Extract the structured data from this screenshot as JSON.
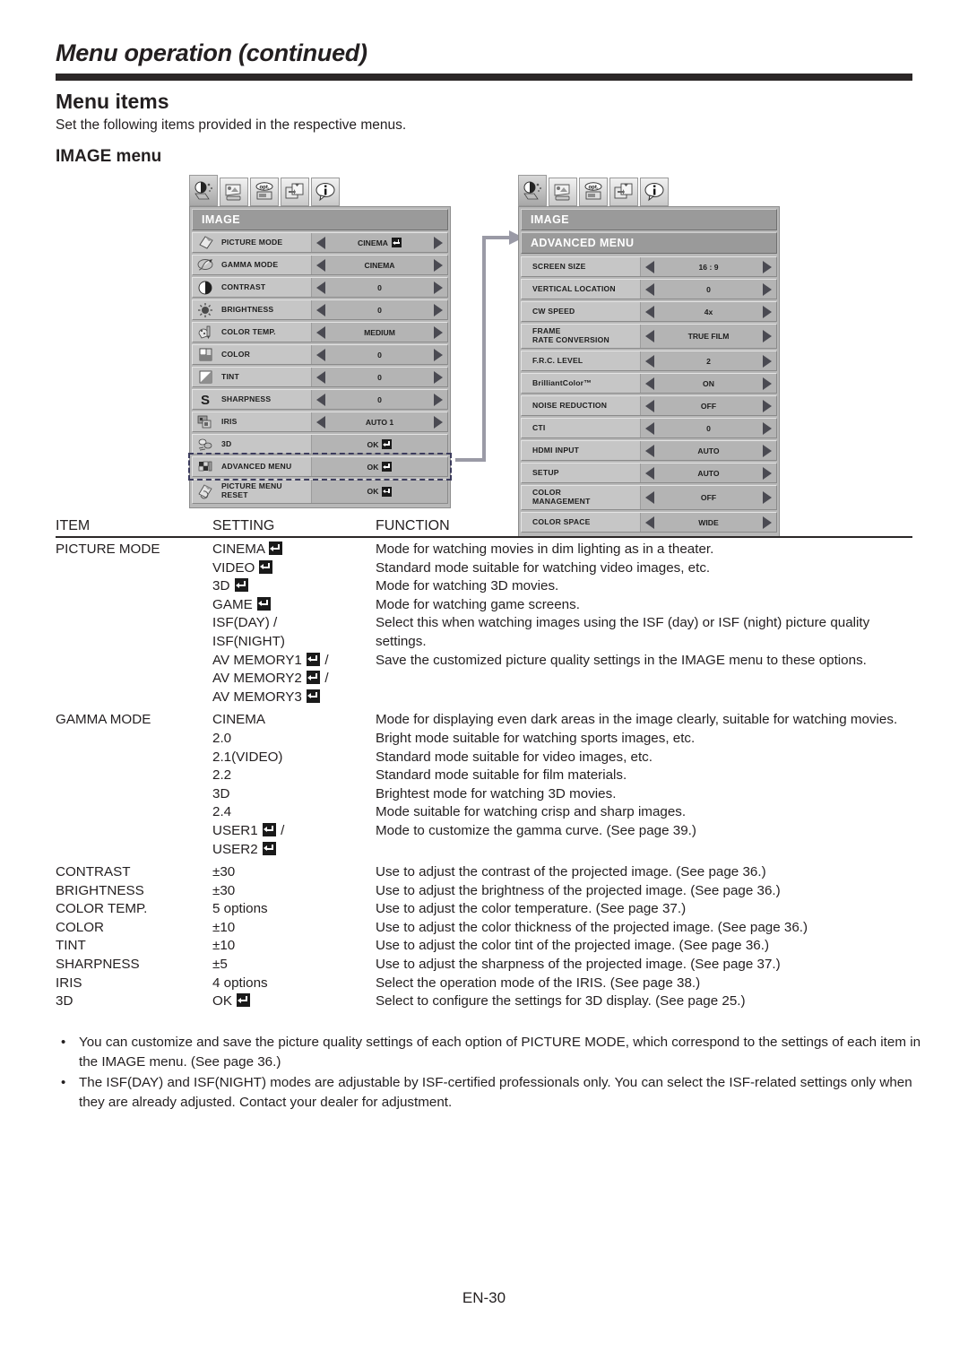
{
  "header": {
    "title": "Menu operation (continued)",
    "section_title": "Menu items",
    "intro": "Set the following items provided in the respective menus.",
    "subsection_title": "IMAGE menu"
  },
  "osd_left": {
    "tabs": [
      "image-tab-icon",
      "install-tab-icon",
      "option-tab-icon",
      "signal-tab-icon",
      "info-tab-icon"
    ],
    "header": "IMAGE",
    "rows": [
      {
        "icon": "picture-mode-icon",
        "label": "PICTURE MODE",
        "value": "CINEMA",
        "ok": true,
        "arrows": true
      },
      {
        "icon": "gamma-mode-icon",
        "label": "GAMMA MODE",
        "value": "CINEMA",
        "ok": false,
        "arrows": true
      },
      {
        "icon": "contrast-icon",
        "label": "CONTRAST",
        "value": "0",
        "ok": false,
        "arrows": true
      },
      {
        "icon": "brightness-icon",
        "label": "BRIGHTNESS",
        "value": "0",
        "ok": false,
        "arrows": true
      },
      {
        "icon": "color-temp-icon",
        "label": "COLOR TEMP.",
        "value": "MEDIUM",
        "ok": false,
        "arrows": true
      },
      {
        "icon": "color-icon",
        "label": "COLOR",
        "value": "0",
        "ok": false,
        "arrows": true
      },
      {
        "icon": "tint-icon",
        "label": "TINT",
        "value": "0",
        "ok": false,
        "arrows": true
      },
      {
        "icon": "sharpness-icon",
        "label": "SHARPNESS",
        "value": "0",
        "ok": false,
        "arrows": true
      },
      {
        "icon": "iris-icon",
        "label": "IRIS",
        "value": "AUTO 1",
        "ok": false,
        "arrows": true
      },
      {
        "icon": "three-d-icon",
        "label": "3D",
        "value": "OK",
        "ok": true,
        "arrows": false
      },
      {
        "icon": "advanced-menu-icon",
        "label": "ADVANCED MENU",
        "value": "OK",
        "ok": true,
        "arrows": false,
        "highlighted": true
      },
      {
        "icon": "picture-menu-reset-icon",
        "label": "PICTURE MENU RESET",
        "value": "OK",
        "ok": true,
        "arrows": false,
        "two_line": true
      }
    ]
  },
  "osd_right": {
    "tabs": [
      "image-tab-icon",
      "install-tab-icon",
      "option-tab-icon",
      "signal-tab-icon",
      "info-tab-icon"
    ],
    "header": "IMAGE",
    "subheader": "ADVANCED MENU",
    "rows": [
      {
        "label": "SCREEN SIZE",
        "value": "16 : 9"
      },
      {
        "label": "VERTICAL LOCATION",
        "value": "0"
      },
      {
        "label": "CW SPEED",
        "value": "4x"
      },
      {
        "label": "FRAME RATE CONVERSION",
        "value": "TRUE FILM",
        "two_line": true
      },
      {
        "label": "F.R.C. LEVEL",
        "value": "2"
      },
      {
        "label": "BrilliantColor™",
        "value": "ON"
      },
      {
        "label": "NOISE REDUCTION",
        "value": "OFF"
      },
      {
        "label": "CTI",
        "value": "0"
      },
      {
        "label": "HDMI INPUT",
        "value": "AUTO"
      },
      {
        "label": "SETUP",
        "value": "AUTO"
      },
      {
        "label": "COLOR MANAGEMENT",
        "value": "OFF",
        "two_line": true
      },
      {
        "label": "COLOR SPACE",
        "value": "WIDE"
      }
    ]
  },
  "table": {
    "headers": {
      "item": "ITEM",
      "setting": "SETTING",
      "function": "FUNCTION"
    },
    "rows": [
      {
        "item": "PICTURE MODE",
        "setting": "CINEMA",
        "setting_ok": true,
        "function": "Mode for watching movies in dim lighting as in a theater."
      },
      {
        "item": "",
        "setting": "VIDEO",
        "setting_ok": true,
        "function": "Standard mode suitable for watching video images, etc."
      },
      {
        "item": "",
        "setting": "3D",
        "setting_ok": true,
        "function": "Mode for watching 3D movies."
      },
      {
        "item": "",
        "setting": "GAME",
        "setting_ok": true,
        "function": "Mode for watching game screens."
      },
      {
        "item": "",
        "setting_lines": [
          "ISF(DAY) /",
          "ISF(NIGHT)"
        ],
        "function": "Select this when watching images using the ISF (day) or ISF (night) picture quality settings."
      },
      {
        "item": "",
        "setting_ok_lines": [
          {
            "text": "AV MEMORY1",
            "ok": true,
            "suffix": " /"
          },
          {
            "text": "AV MEMORY2",
            "ok": true,
            "suffix": " /"
          },
          {
            "text": "AV MEMORY3",
            "ok": true,
            "suffix": ""
          }
        ],
        "function": "Save the customized picture quality settings in the IMAGE menu to these options."
      },
      {
        "item": "GAMMA MODE",
        "setting": "CINEMA",
        "function": "Mode for displaying even dark areas in the image clearly, suitable for watching movies."
      },
      {
        "item": "",
        "setting": "2.0",
        "function": "Bright mode suitable for watching sports images, etc."
      },
      {
        "item": "",
        "setting": "2.1(VIDEO)",
        "function": "Standard mode suitable for video images, etc."
      },
      {
        "item": "",
        "setting": "2.2",
        "function": "Standard mode suitable for film materials."
      },
      {
        "item": "",
        "setting": "3D",
        "function": "Brightest mode for watching 3D movies."
      },
      {
        "item": "",
        "setting": "2.4",
        "function": "Mode suitable for watching crisp and sharp images."
      },
      {
        "item": "",
        "setting_ok_lines": [
          {
            "text": "USER1",
            "ok": true,
            "suffix": " /"
          },
          {
            "text": "USER2",
            "ok": true,
            "suffix": ""
          }
        ],
        "function": "Mode to customize the gamma curve. (See page 39.)"
      },
      {
        "item": "CONTRAST",
        "setting": "±30",
        "function": "Use to adjust the contrast of the projected image. (See page 36.)"
      },
      {
        "item": "BRIGHTNESS",
        "setting": "±30",
        "function": "Use to adjust the brightness of the projected image. (See page 36.)"
      },
      {
        "item": "COLOR TEMP.",
        "setting": "5 options",
        "function": "Use to adjust the color temperature. (See page 37.)"
      },
      {
        "item": "COLOR",
        "setting": "±10",
        "function": "Use to adjust the color thickness of the projected image. (See page 36.)"
      },
      {
        "item": "TINT",
        "setting": "±10",
        "function": "Use to adjust the color tint of the projected image. (See page 36.)"
      },
      {
        "item": "SHARPNESS",
        "setting": "±5",
        "function": "Use to adjust the sharpness of the projected image. (See page 37.)"
      },
      {
        "item": "IRIS",
        "setting": "4 options",
        "function": "Select the operation mode of the IRIS. (See page 38.)"
      },
      {
        "item": "3D",
        "setting": "OK",
        "setting_ok": true,
        "function": "Select to configure the settings for 3D display. (See page 25.)"
      }
    ]
  },
  "notes": [
    "You can customize and save the picture quality settings of each option of PICTURE MODE, which correspond to the settings of each item in the IMAGE menu. (See page 36.)",
    "The ISF(DAY) and ISF(NIGHT) modes are adjustable by ISF-certified professionals only. You can select the ISF-related settings only when they are already adjusted. Contact your dealer for adjustment."
  ],
  "footer": {
    "page": "EN-30"
  }
}
